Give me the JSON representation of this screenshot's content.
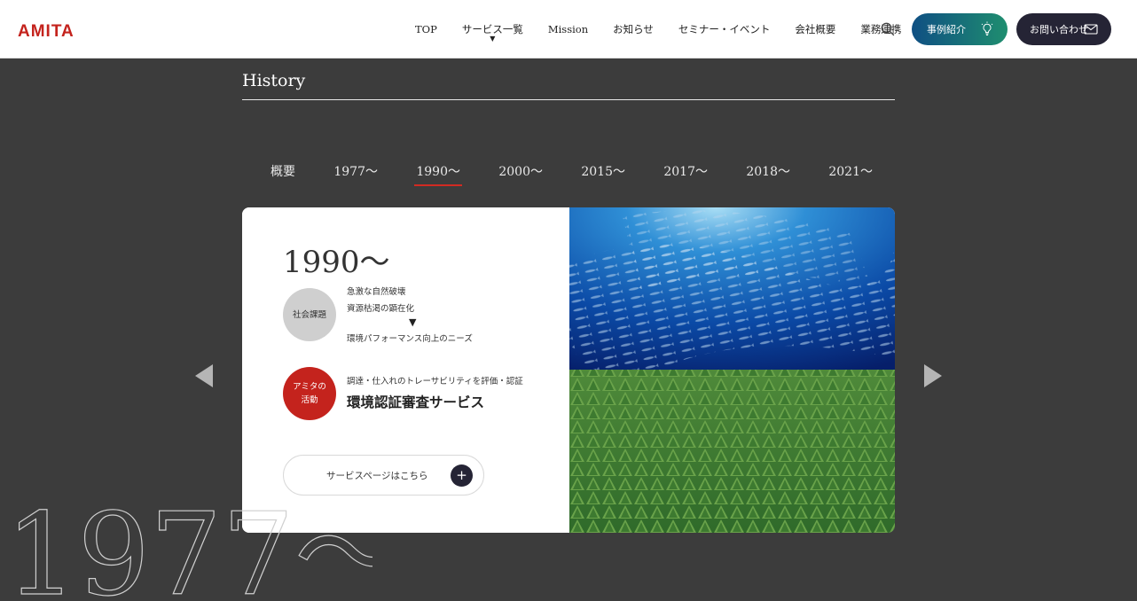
{
  "header": {
    "logo": "AMITA",
    "nav": [
      {
        "label": "TOP"
      },
      {
        "label": "サービス一覧",
        "has_dropdown": true,
        "caret": "▼"
      },
      {
        "label": "Mission"
      },
      {
        "label": "お知らせ"
      },
      {
        "label": "セミナー・イベント"
      },
      {
        "label": "会社概要"
      },
      {
        "label": "業務連携"
      }
    ],
    "search_icon": "search-icon",
    "cases_button": {
      "label": "事例紹介",
      "icon": "lightbulb-icon"
    },
    "contact_button": {
      "label": "お問い合わせ",
      "icon": "mail-icon"
    }
  },
  "history": {
    "title": "History",
    "tabs": [
      "概要",
      "1977〜",
      "1990〜",
      "2000〜",
      "2015〜",
      "2017〜",
      "2018〜",
      "2021〜"
    ],
    "active_tab": "1990〜",
    "card": {
      "era": "1990〜",
      "issue_label": "社会課題",
      "issues": [
        "急激な自然破壊",
        "資源枯渇の顕在化"
      ],
      "issue_arrow": "▼",
      "issue_result": "環境パフォーマンス向上のニーズ",
      "activity_label_1": "アミタの",
      "activity_label_2": "活動",
      "activity_sub": "調達・仕入れのトレーサビリティを評価・認証",
      "activity_main": "環境認証審査サービス",
      "service_button": "サービスページはこちら",
      "service_button_icon": "+"
    },
    "background_year": "1977〜"
  },
  "colors": {
    "brand_red": "#c4231d",
    "navy": "#252435",
    "background": "#3c3c3c",
    "cases_gradient_start": "#0f4f83",
    "cases_gradient_end": "#1f8e6f"
  }
}
